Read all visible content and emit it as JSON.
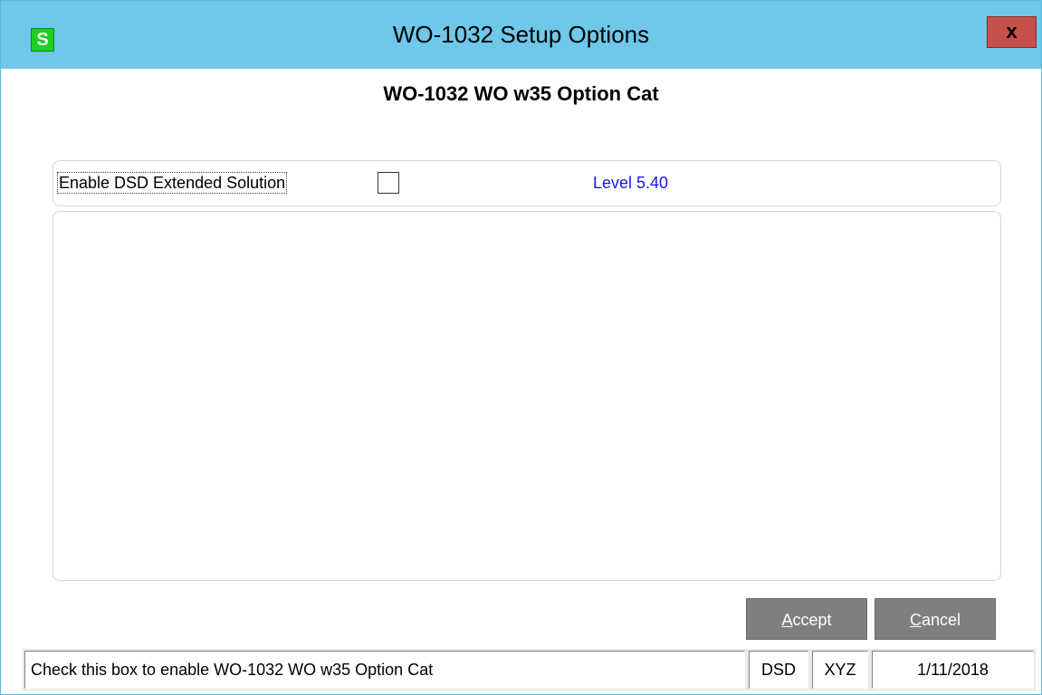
{
  "window": {
    "title": "WO-1032 Setup Options",
    "app_icon_letter": "S",
    "close_label": "x"
  },
  "heading": "WO-1032 WO w35 Option Cat",
  "option": {
    "enable_label": "Enable DSD Extended Solution",
    "checked": false,
    "level": "Level 5.40"
  },
  "buttons": {
    "accept_first": "A",
    "accept_rest": "ccept",
    "cancel_first": "C",
    "cancel_rest": "ancel"
  },
  "statusbar": {
    "message": "Check this box to enable WO-1032 WO w35 Option Cat",
    "module": "DSD",
    "company": "XYZ",
    "date": "1/11/2018"
  },
  "colors": {
    "titlebar": "#6fc7ea",
    "close_button": "#c8504a",
    "app_icon": "#1fce22",
    "level_text": "#1717e8",
    "button_bg": "#7f7f7f"
  }
}
